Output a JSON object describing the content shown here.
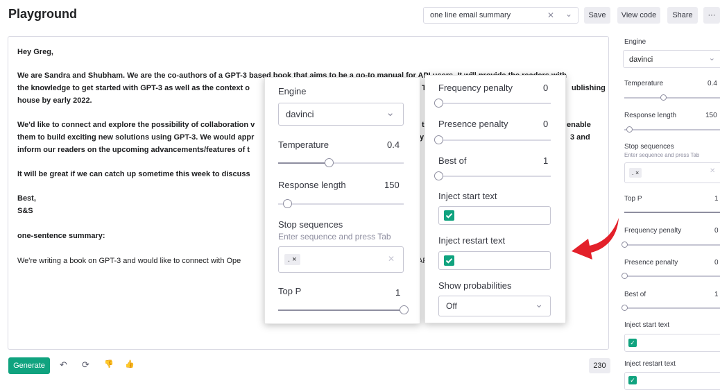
{
  "header": {
    "title": "Playground",
    "preset_value": "one line email summary",
    "save_label": "Save",
    "view_code_label": "View code",
    "share_label": "Share",
    "more_label": "···"
  },
  "editor": {
    "greeting": "Hey Greg,",
    "para1_line1": "We are Sandra and Shubham. We are the co-authors of a GPT-3 based book that aims to be a go-to manual for API users. It will provide the readers with",
    "para1_line2a": "the knowledge to get started with GPT-3 as well as the context o",
    "para1_line2b": "T",
    "para1_line2c": "ublishing",
    "para1_line3": "house by early 2022.",
    "para2_line1a": "We'd like to connect and explore the possibility of collaboration v",
    "para2_line1b": "t",
    "para2_line1c": "enable",
    "para2_line2a": "them to build exciting new solutions using GPT-3. We would appr",
    "para2_line2b": "ly",
    "para2_line2c": "3 and",
    "para2_line3": "inform our readers on the upcoming advancements/features of t",
    "para3": "It will be great if we can catch up sometime this week to discuss",
    "signoff1": "Best,",
    "signoff2": "S&S",
    "prompt_label": "one-sentence summary:",
    "completion_a": "We're writing a book on GPT-3 and would like to connect with Ope",
    "completion_b": "AF"
  },
  "footer": {
    "generate_label": "Generate",
    "undo_icon": "↶",
    "regenerate_icon": "⟳",
    "thumbs_down_icon": "👎",
    "thumbs_up_icon": "👍",
    "token_count": "230"
  },
  "sidebar": {
    "engine_label": "Engine",
    "engine_value": "davinci",
    "temperature_label": "Temperature",
    "temperature_value": "0.4",
    "response_length_label": "Response length",
    "response_length_value": "150",
    "stop_sequences_label": "Stop sequences",
    "stop_sequences_placeholder": "Enter sequence and press Tab",
    "stop_token": ". ×",
    "top_p_label": "Top P",
    "top_p_value": "1",
    "frequency_penalty_label": "Frequency penalty",
    "frequency_penalty_value": "0",
    "presence_penalty_label": "Presence penalty",
    "presence_penalty_value": "0",
    "best_of_label": "Best of",
    "best_of_value": "1",
    "inject_start_label": "Inject start text",
    "inject_restart_label": "Inject restart text"
  },
  "zoom_left": {
    "engine_label": "Engine",
    "engine_value": "davinci",
    "temperature_label": "Temperature",
    "temperature_value": "0.4",
    "response_length_label": "Response length",
    "response_length_value": "150",
    "stop_sequences_label": "Stop sequences",
    "stop_sequences_placeholder": "Enter sequence and press Tab",
    "stop_token": ". ×",
    "top_p_label": "Top P",
    "top_p_value": "1"
  },
  "zoom_right": {
    "frequency_penalty_label": "Frequency penalty",
    "frequency_penalty_value": "0",
    "presence_penalty_label": "Presence penalty",
    "presence_penalty_value": "0",
    "best_of_label": "Best of",
    "best_of_value": "1",
    "inject_start_label": "Inject start text",
    "inject_restart_label": "Inject restart text",
    "show_probabilities_label": "Show probabilities",
    "show_probabilities_value": "Off"
  },
  "colors": {
    "accent": "#10a37f",
    "arrow": "#e3202a"
  }
}
